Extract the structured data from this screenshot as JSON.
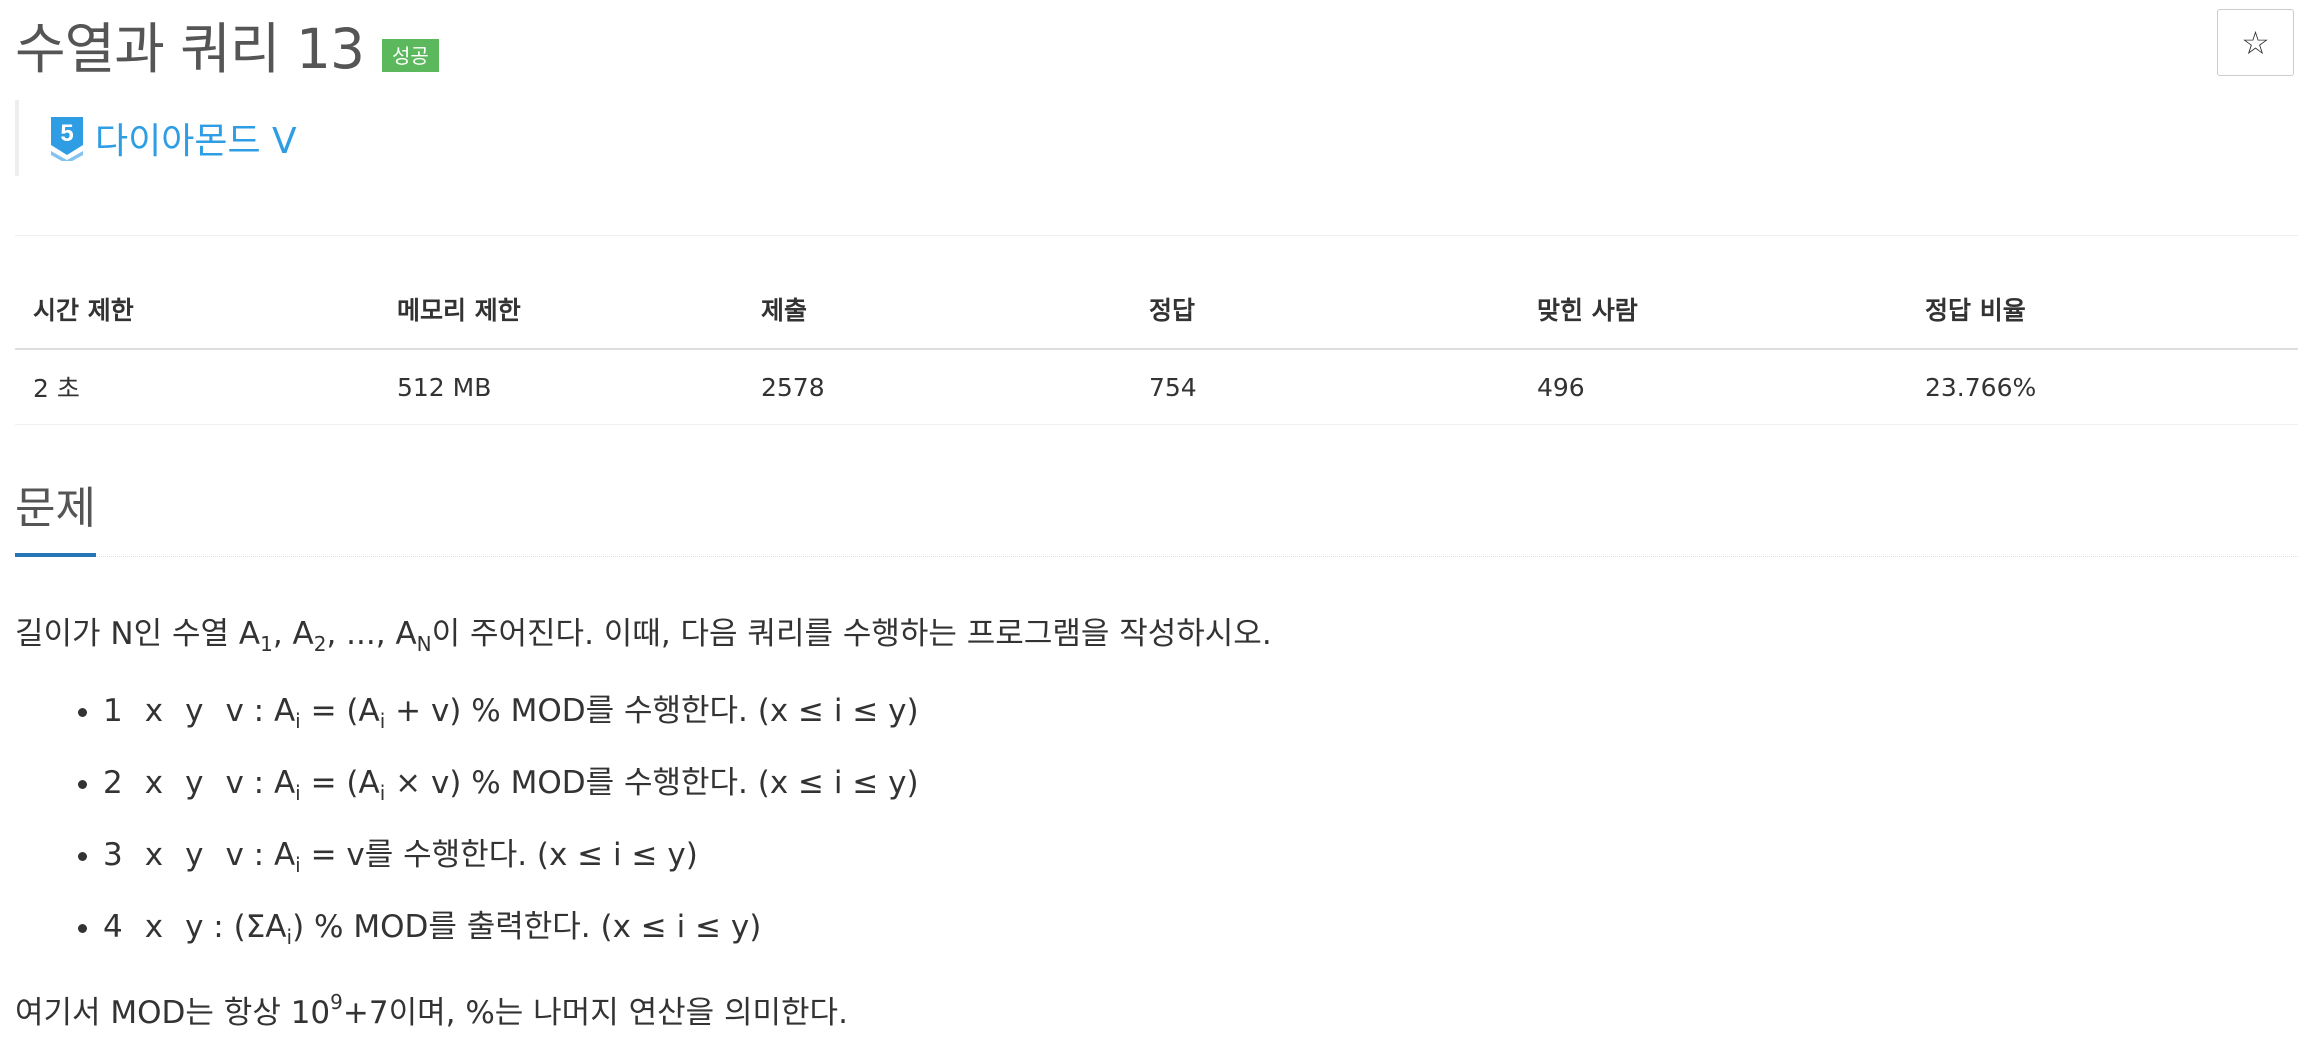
{
  "problem": {
    "title": "수열과 쿼리 13",
    "status_badge": "성공",
    "star_label": "☆",
    "tier": {
      "number": "5",
      "label": "다이아몬드 V",
      "color": "#2f9de4"
    }
  },
  "info_table": {
    "headers": [
      "시간 제한",
      "메모리 제한",
      "제출",
      "정답",
      "맞힌 사람",
      "정답 비율"
    ],
    "values": [
      "2 초",
      "512 MB",
      "2578",
      "754",
      "496",
      "23.766%"
    ]
  },
  "section": {
    "title": "문제"
  },
  "statement": {
    "intro_1": "길이가 N인 수열 A",
    "intro_sub_1": "1",
    "intro_2": ", A",
    "intro_sub_2": "2",
    "intro_3": ", ..., A",
    "intro_sub_N": "N",
    "intro_4": "이 주어진다. 이때, 다음 쿼리를 수행하는 프로그램을 작성하시오.",
    "queries": [
      {
        "q1": "1",
        "q2": "x",
        "q3": "y",
        "q4": "v",
        "colon": " : A",
        "sub": "i",
        "t1": " = (A",
        "sub2": "i",
        "t2": " + v) % MOD를 수행한다. (x ≤ i ≤ y)"
      },
      {
        "q1": "2",
        "q2": "x",
        "q3": "y",
        "q4": "v",
        "colon": " : A",
        "sub": "i",
        "t1": " = (A",
        "sub2": "i",
        "t2": " × v) % MOD를 수행한다. (x ≤ i ≤ y)"
      },
      {
        "q1": "3",
        "q2": "x",
        "q3": "y",
        "q4": "v",
        "colon": " : A",
        "sub": "i",
        "t1": " = v를 수행한다. (x ≤ i ≤ y)"
      },
      {
        "q1": "4",
        "q2": "x",
        "q3": "y",
        "colon": " : (ΣA",
        "sub": "i",
        "t1": ") % MOD를 출력한다. (x ≤ i ≤ y)"
      }
    ],
    "mod_1": "여기서 MOD는 항상 10",
    "mod_sup": "9",
    "mod_2": "+7이며, %는 나머지 연산을 의미한다."
  },
  "colors": {
    "accent": "#2774b7",
    "success": "#5cb85c",
    "tier": "#2f9de4"
  }
}
